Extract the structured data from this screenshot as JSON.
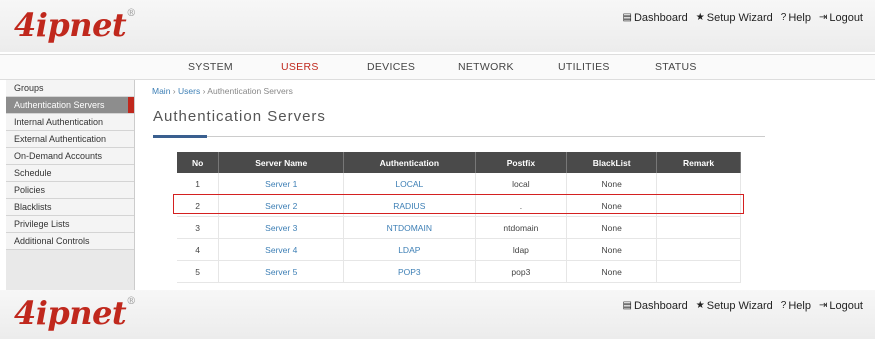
{
  "brand": {
    "logo": "4ipnet",
    "reg": "®"
  },
  "toplinks": {
    "dashboard": "Dashboard",
    "setup_wizard": "Setup Wizard",
    "help": "Help",
    "logout": "Logout"
  },
  "nav": [
    "SYSTEM",
    "USERS",
    "DEVICES",
    "NETWORK",
    "UTILITIES",
    "STATUS"
  ],
  "nav_active": "USERS",
  "sidebar": [
    "Groups",
    "Authentication Servers",
    "Internal Authentication",
    "External Authentication",
    "On-Demand Accounts",
    "Schedule",
    "Policies",
    "Blacklists",
    "Privilege Lists",
    "Additional Controls"
  ],
  "breadcrumb": {
    "main": "Main",
    "sep": " › ",
    "users": "Users",
    "current": "Authentication Servers"
  },
  "page_title": "Authentication Servers",
  "table": {
    "headers": [
      "No",
      "Server Name",
      "Authentication",
      "Postfix",
      "BlackList",
      "Remark"
    ],
    "rows": [
      [
        "1",
        "Server 1",
        "LOCAL",
        "local",
        "None",
        ""
      ],
      [
        "2",
        "Server 2",
        "RADIUS",
        ".",
        "None",
        ""
      ],
      [
        "3",
        "Server 3",
        "NTDOMAIN",
        "ntdomain",
        "None",
        ""
      ],
      [
        "4",
        "Server 4",
        "LDAP",
        "ldap",
        "None",
        ""
      ],
      [
        "5",
        "Server 5",
        "POP3",
        "pop3",
        "None",
        ""
      ]
    ]
  },
  "colors": {
    "accent": "#c0281d",
    "link": "#3d7fb5",
    "header_bg": "#4a4a4a",
    "highlight": "#d42020"
  }
}
